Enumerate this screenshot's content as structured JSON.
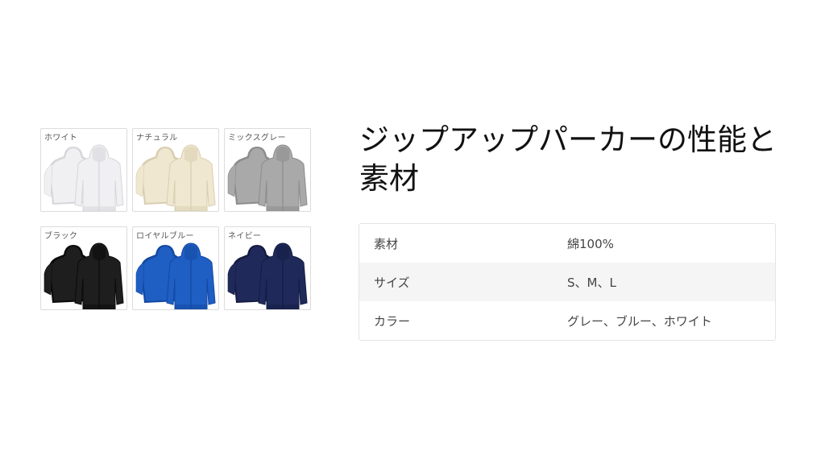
{
  "color_swatches": [
    {
      "label": "ホワイト",
      "color": "#f0f0f2",
      "shade": "#d6d6da"
    },
    {
      "label": "ナチュラル",
      "color": "#efe7cf",
      "shade": "#d8ceb0"
    },
    {
      "label": "ミックスグレー",
      "color": "#a9a9a9",
      "shade": "#8c8c8c"
    },
    {
      "label": "ブラック",
      "color": "#1e1e1e",
      "shade": "#0a0a0a"
    },
    {
      "label": "ロイヤルブルー",
      "color": "#1f5fc4",
      "shade": "#1448a0"
    },
    {
      "label": "ネイビー",
      "color": "#1f2a5a",
      "shade": "#141c42"
    }
  ],
  "title": "ジップアップパーカーの性能と素材",
  "spec_table": {
    "rows": [
      {
        "key": "素材",
        "value": "綿100%"
      },
      {
        "key": "サイズ",
        "value": "S、M、L"
      },
      {
        "key": "カラー",
        "value": "グレー、ブルー、ホワイト"
      }
    ]
  }
}
